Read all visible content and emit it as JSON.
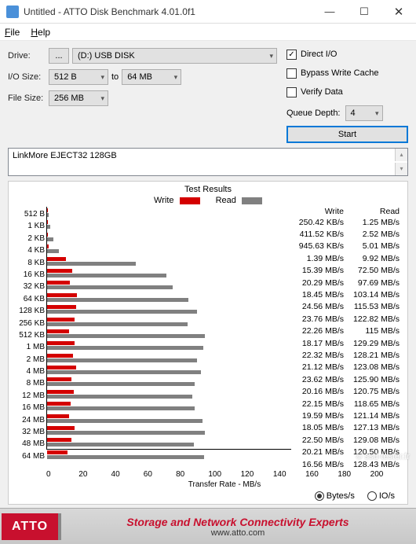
{
  "window": {
    "title": "Untitled - ATTO Disk Benchmark 4.01.0f1"
  },
  "menu": {
    "file": "File",
    "help": "Help"
  },
  "form": {
    "drive_label": "Drive:",
    "dots": "...",
    "drive": "(D:) USB DISK",
    "io_label": "I/O Size:",
    "io_from": "512 B",
    "to": "to",
    "io_to": "64 MB",
    "fs_label": "File Size:",
    "fs": "256 MB"
  },
  "opts": {
    "direct": "Direct I/O",
    "bypass": "Bypass Write Cache",
    "verify": "Verify Data",
    "qd_label": "Queue Depth:",
    "qd": "4",
    "start": "Start"
  },
  "device": "LinkMore EJECT32 128GB",
  "results_title": "Test Results",
  "legend": {
    "write": "Write",
    "read": "Read"
  },
  "xlabel": "Transfer Rate - MB/s",
  "col_write": "Write",
  "col_read": "Read",
  "radios": {
    "bytes": "Bytes/s",
    "ios": "IO/s"
  },
  "footer": {
    "brand": "ATTO",
    "tag": "Storage and Network Connectivity Experts",
    "url": "www.atto.com"
  },
  "watermark": "© ssd-tester.fr",
  "chart_data": {
    "type": "bar",
    "title": "Test Results",
    "xlabel": "Transfer Rate - MB/s",
    "ylabel": "I/O Size",
    "xlim": [
      0,
      200
    ],
    "xticks": [
      0,
      20,
      40,
      60,
      80,
      100,
      120,
      140,
      160,
      180,
      200
    ],
    "categories": [
      "512 B",
      "1 KB",
      "2 KB",
      "4 KB",
      "8 KB",
      "16 KB",
      "32 KB",
      "64 KB",
      "128 KB",
      "256 KB",
      "512 KB",
      "1 MB",
      "2 MB",
      "4 MB",
      "8 MB",
      "12 MB",
      "16 MB",
      "24 MB",
      "32 MB",
      "48 MB",
      "64 MB"
    ],
    "series": [
      {
        "name": "Write",
        "unit": "MB/s",
        "display": [
          "250.42 KB/s",
          "411.52 KB/s",
          "945.63 KB/s",
          "1.39 MB/s",
          "15.39 MB/s",
          "20.29 MB/s",
          "18.45 MB/s",
          "24.56 MB/s",
          "23.76 MB/s",
          "22.26 MB/s",
          "18.17 MB/s",
          "22.32 MB/s",
          "21.12 MB/s",
          "23.62 MB/s",
          "20.16 MB/s",
          "22.15 MB/s",
          "19.59 MB/s",
          "18.05 MB/s",
          "22.50 MB/s",
          "20.21 MB/s",
          "16.56 MB/s"
        ],
        "values": [
          0.25,
          0.41,
          0.95,
          1.39,
          15.39,
          20.29,
          18.45,
          24.56,
          23.76,
          22.26,
          18.17,
          22.32,
          21.12,
          23.62,
          20.16,
          22.15,
          19.59,
          18.05,
          22.5,
          20.21,
          16.56
        ]
      },
      {
        "name": "Read",
        "unit": "MB/s",
        "display": [
          "1.25 MB/s",
          "2.52 MB/s",
          "5.01 MB/s",
          "9.92 MB/s",
          "72.50 MB/s",
          "97.69 MB/s",
          "103.14 MB/s",
          "115.53 MB/s",
          "122.82 MB/s",
          "115 MB/s",
          "129.29 MB/s",
          "128.21 MB/s",
          "123.08 MB/s",
          "125.90 MB/s",
          "120.75 MB/s",
          "118.65 MB/s",
          "121.14 MB/s",
          "127.13 MB/s",
          "129.08 MB/s",
          "120.50 MB/s",
          "128.43 MB/s"
        ],
        "values": [
          1.25,
          2.52,
          5.01,
          9.92,
          72.5,
          97.69,
          103.14,
          115.53,
          122.82,
          115,
          129.29,
          128.21,
          123.08,
          125.9,
          120.75,
          118.65,
          121.14,
          127.13,
          129.08,
          120.5,
          128.43
        ]
      }
    ]
  }
}
